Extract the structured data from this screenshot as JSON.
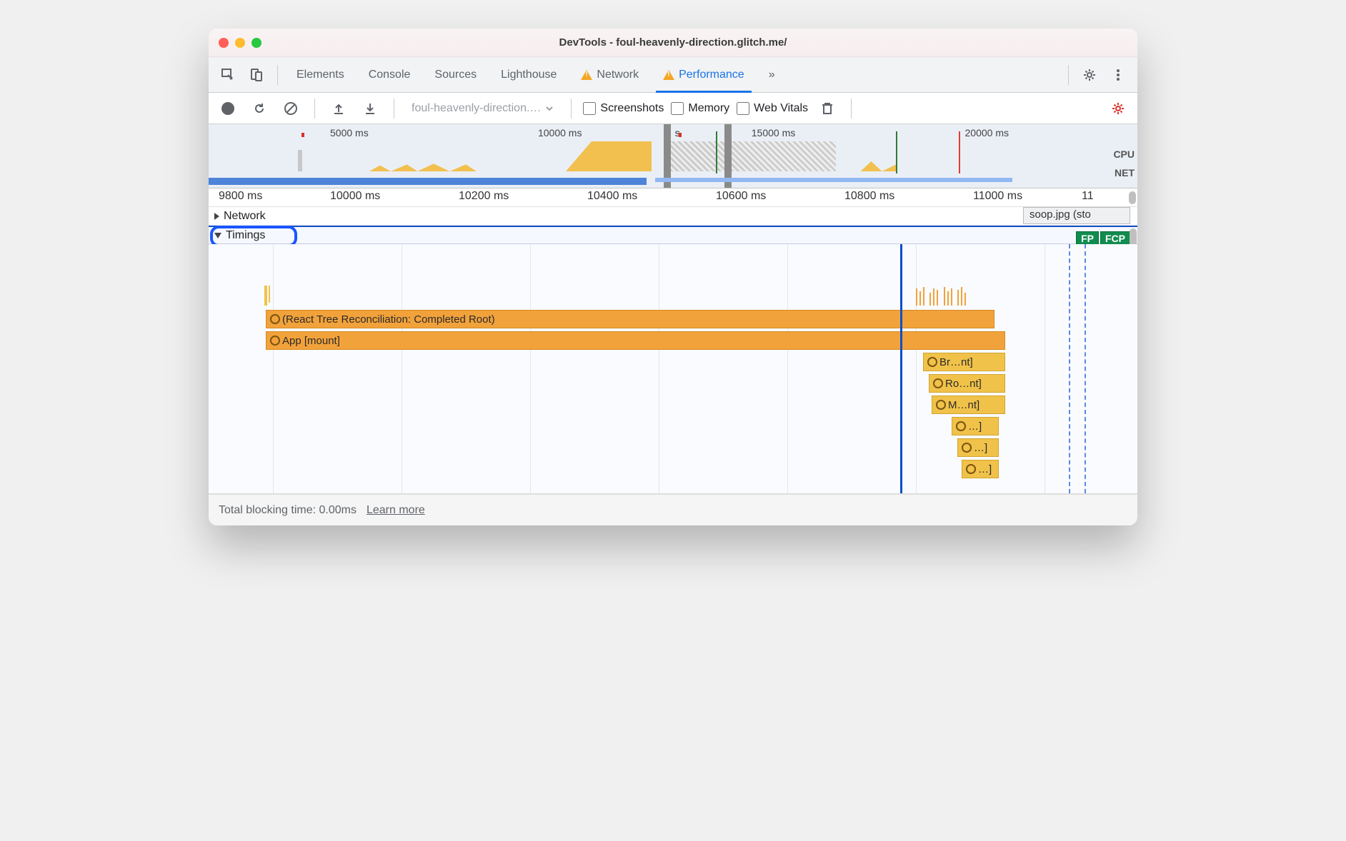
{
  "window_title": "DevTools - foul-heavenly-direction.glitch.me/",
  "tabs": {
    "elements": "Elements",
    "console": "Console",
    "sources": "Sources",
    "lighthouse": "Lighthouse",
    "network": "Network",
    "performance": "Performance",
    "more": "»"
  },
  "toolbar": {
    "dropdown": "foul-heavenly-direction.…",
    "screenshots": "Screenshots",
    "memory": "Memory",
    "webvitals": "Web Vitals"
  },
  "overview_ticks": [
    "5000 ms",
    "10000 ms",
    "15000 ms",
    "20000 ms"
  ],
  "overview_labels": {
    "cpu": "CPU",
    "net": "NET"
  },
  "ruler_ticks": [
    "9800 ms",
    "10000 ms",
    "10200 ms",
    "10400 ms",
    "10600 ms",
    "10800 ms",
    "11000 ms",
    "11"
  ],
  "sections": {
    "network": "Network",
    "timings": "Timings"
  },
  "network_block": "soop.jpg (sto",
  "paint_markers": {
    "fp": "FP",
    "fcp": "FCP"
  },
  "flame": {
    "row0": "(React Tree Reconciliation: Completed Root)",
    "row1": "App [mount]",
    "row2": "Br…nt]",
    "row3": "Ro…nt]",
    "row4": "M…nt]",
    "row5": "…]",
    "row6": "…]",
    "row7": "…]"
  },
  "footer": {
    "tbt": "Total blocking time: 0.00ms",
    "learn": "Learn more"
  },
  "overview_letter": "s"
}
